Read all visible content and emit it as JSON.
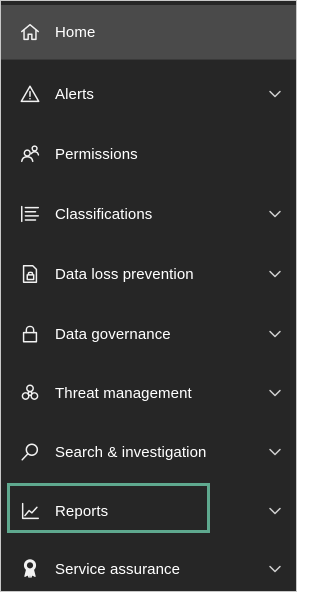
{
  "nav": {
    "items": [
      {
        "label": "Home",
        "icon": "home-icon",
        "expandable": false,
        "active": true
      },
      {
        "label": "Alerts",
        "icon": "alert-triangle-icon",
        "expandable": true
      },
      {
        "label": "Permissions",
        "icon": "people-icon",
        "expandable": false
      },
      {
        "label": "Classifications",
        "icon": "list-icon",
        "expandable": true
      },
      {
        "label": "Data loss prevention",
        "icon": "lock-document-icon",
        "expandable": true
      },
      {
        "label": "Data governance",
        "icon": "lock-icon",
        "expandable": true
      },
      {
        "label": "Threat management",
        "icon": "biohazard-icon",
        "expandable": true
      },
      {
        "label": "Search & investigation",
        "icon": "search-icon",
        "expandable": true
      },
      {
        "label": "Reports",
        "icon": "chart-line-icon",
        "expandable": true,
        "highlighted": true
      },
      {
        "label": "Service assurance",
        "icon": "ribbon-icon",
        "expandable": true
      }
    ]
  },
  "colors": {
    "background": "#262626",
    "active_background": "#4a4a4a",
    "text": "#ffffff",
    "highlight_border": "#5fa98f"
  }
}
